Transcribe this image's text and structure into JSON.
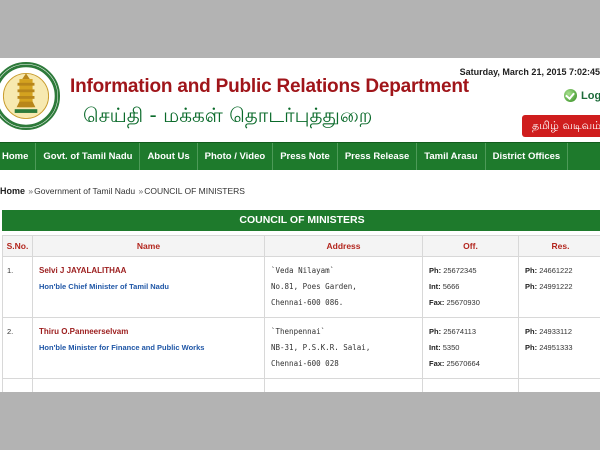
{
  "header": {
    "department_en": "Information and Public Relations Department",
    "department_ta": "செய்தி - மக்கள் தொடர்புத்துறை",
    "date": "Saturday, March 21, 2015 7:02:45",
    "login_label": "Login",
    "language_button": "தமிழ் வடிவம்",
    "emblem_text_top": "GOVERNMENT OF TAMIL NADU",
    "emblem_text_bottom": "SATYAMEVA JAYATE"
  },
  "nav": {
    "items": [
      "Home",
      "Govt. of Tamil Nadu",
      "About Us",
      "Photo / Video",
      "Press Note",
      "Press Release",
      "Tamil Arasu",
      "District Offices"
    ]
  },
  "breadcrumb": {
    "home": "Home",
    "sep": "»",
    "level1": "Government of Tamil Nadu",
    "current": "COUNCIL OF MINISTERS"
  },
  "council": {
    "title": "COUNCIL OF MINISTERS",
    "columns": [
      "S.No.",
      "Name",
      "Address",
      "Off.",
      "Res."
    ],
    "rows": [
      {
        "sno": "1.",
        "name": "Selvi J JAYALALITHAA",
        "role": "Hon'ble Chief Minister of Tamil Nadu",
        "address": [
          "`Veda Nilayam`",
          "No.81, Poes Garden,",
          "Chennai-600 086."
        ],
        "off_ph": "25672345",
        "off_int": "5666",
        "off_fax": "25670930",
        "res_ph1": "24661222",
        "res_ph2": "24991222"
      },
      {
        "sno": "2.",
        "name": "Thiru O.Panneerselvam",
        "role": "Hon'ble Minister for Finance and Public Works",
        "address": [
          "`Thenpennai`",
          "NB-31, P.S.K.R. Salai,",
          "Chennai-600 028"
        ],
        "off_ph": "25674113",
        "off_int": "5350",
        "off_fax": "25670664",
        "res_ph1": "24933112",
        "res_ph2": "24951333"
      }
    ],
    "labels": {
      "ph": "Ph:",
      "int": "Int:",
      "fax": "Fax:"
    }
  }
}
